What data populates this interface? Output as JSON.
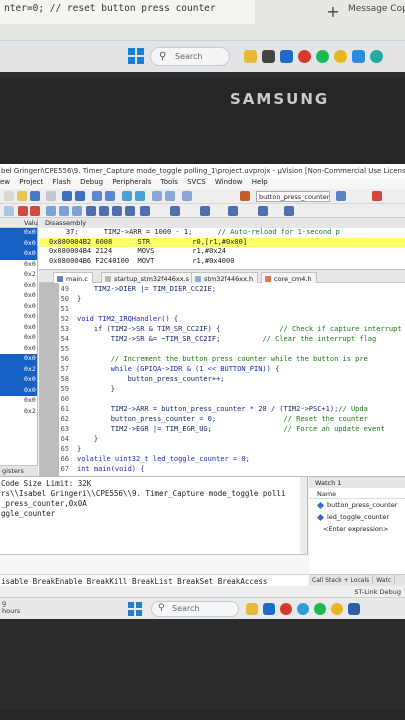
{
  "photo_top": {
    "code_snippet": "nter=0;        // reset button press counter",
    "new_tab_symbol": "+",
    "message_text": "Message Cop"
  },
  "upper_taskbar": {
    "search_placeholder": "Search"
  },
  "monitor": {
    "brand": "SAMSUNG"
  },
  "ide": {
    "title": "bel Gringeri\\CPE556\\9. Timer_Capture mode_toggle polling_1\\project.uvprojx - µVision [Non-Commercial Use License]",
    "menu": [
      "ew",
      "Project",
      "Flash",
      "Debug",
      "Peripherals",
      "Tools",
      "SVCS",
      "Window",
      "Help"
    ],
    "target_value": "button_press_counter",
    "registers": {
      "header": "Valu",
      "rows": [
        "0x0",
        "0x0",
        "0x0",
        "0x0",
        "0x2",
        "0x0",
        "0x0",
        "0x0",
        "0x0",
        "0x0",
        "0x0",
        "0x0",
        "0x0",
        "0x2",
        "0x0",
        "0x0",
        "0x0",
        "0x2"
      ],
      "footer": "gisters"
    },
    "disassembly": {
      "title": "Disassembly",
      "lines": [
        {
          "text": "    37:      TIM2->ARR = 1000 - 1;",
          "comment": "// Auto-reload for 1-second p"
        },
        {
          "text": "0x080004B2 6008      STR          r0,[r1,#0x00]",
          "comment": ""
        },
        {
          "text": "0x080004B4 2124      MOVS         r1,#0x24",
          "comment": ""
        },
        {
          "text": "0x080004B6 F2C40100  MOVT         r1,#0x4000",
          "comment": ""
        }
      ]
    },
    "tabs": [
      "main.c",
      "startup_stm32f446xx.s",
      "stm32f446xx.h",
      "core_cm4.h"
    ],
    "code": [
      {
        "ln": "49",
        "text": "    TIM2->DIER |= TIM_DIER_CC2IE;",
        "comment": ""
      },
      {
        "ln": "50",
        "text": "}",
        "comment": ""
      },
      {
        "ln": "51",
        "text": "",
        "comment": ""
      },
      {
        "ln": "52",
        "text": "void TIM2_IRQHandler() {",
        "comment": ""
      },
      {
        "ln": "53",
        "text": "    if (TIM2->SR & TIM_SR_CC2IF) {",
        "comment": "// Check if capture interrupt"
      },
      {
        "ln": "54",
        "text": "        TIM2->SR &= ~TIM_SR_CC2IF;",
        "comment": "// Clear the interrupt flag"
      },
      {
        "ln": "55",
        "text": "",
        "comment": ""
      },
      {
        "ln": "56",
        "text": "        ",
        "comment": "// Increment the button press counter while the button is pre"
      },
      {
        "ln": "57",
        "text": "        while (GPIOA->IDR & (1 << BUTTON_PIN)) {",
        "comment": ""
      },
      {
        "ln": "58",
        "text": "            button_press_counter++;",
        "comment": ""
      },
      {
        "ln": "59",
        "text": "        }",
        "comment": ""
      },
      {
        "ln": "60",
        "text": "",
        "comment": ""
      },
      {
        "ln": "61",
        "text": "        TIM2->ARR = button_press_counter * 20 / (TIM2->PSC+1);",
        "comment": "// Upda"
      },
      {
        "ln": "62",
        "text": "        button_press_counter = 0;",
        "comment": "// Reset the counter"
      },
      {
        "ln": "63",
        "text": "        TIM2->EGR |= TIM_EGR_UG;",
        "comment": "// Force an update event"
      },
      {
        "ln": "64",
        "text": "    }",
        "comment": ""
      },
      {
        "ln": "65",
        "text": "}",
        "comment": ""
      },
      {
        "ln": "66",
        "text": "volatile uint32_t led_toggle_counter = 0;",
        "comment": ""
      },
      {
        "ln": "67",
        "text": "int main(void) {",
        "comment": ""
      }
    ],
    "command": [
      "Code Size Limit: 32K",
      "rs\\\\Isabel Gringeri\\\\CPE556\\\\9. Timer_Capture mode_toggle polli",
      "_press_counter,0x0A",
      "ggle_counter"
    ],
    "breakpoint_cmds": "isable BreakEnable BreakKill BreakList BreakSet BreakAccess",
    "watch": {
      "title": "Watch 1",
      "header": "Name",
      "items": [
        "button_press_counter",
        "led_toggle_counter"
      ],
      "enter": "<Enter expression>",
      "tabs": [
        "Call Stack + Locals",
        "Watc"
      ]
    },
    "status": "ST-Link Debug",
    "taskbar": {
      "left_line1": "g",
      "left_line2": "hours",
      "search_placeholder": "Search"
    }
  }
}
